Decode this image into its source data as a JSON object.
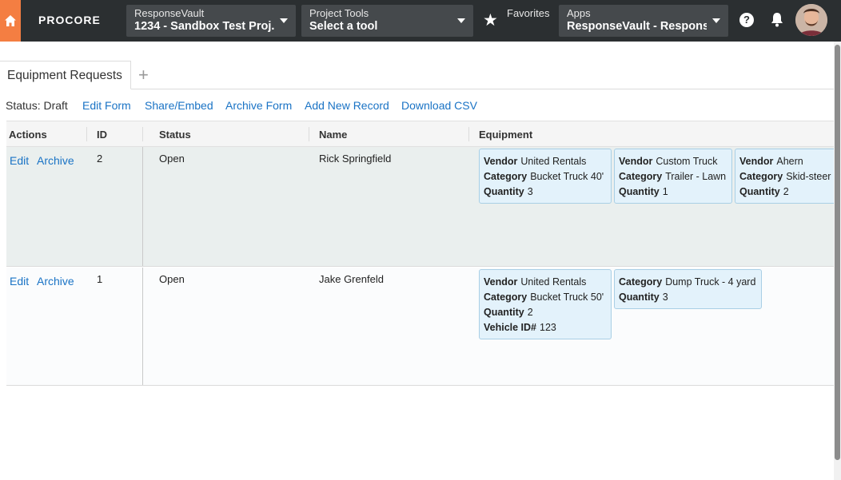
{
  "nav": {
    "logo": "PROCORE",
    "project_selector": {
      "sub": "ResponseVault",
      "main": "1234 - Sandbox Test Proj..."
    },
    "tool_selector": {
      "sub": "Project Tools",
      "main": "Select a tool"
    },
    "favorites_label": "Favorites",
    "apps_selector": {
      "sub": "Apps",
      "main": "ResponseVault - Respons..."
    },
    "help_label": "?",
    "brand_color": "#f47e42"
  },
  "tabs": [
    {
      "label": "Equipment Requests"
    }
  ],
  "add_tab": "+",
  "toolbar": {
    "status": "Status: Draft",
    "links": [
      "Edit Form",
      "Share/Embed",
      "Archive Form",
      "Add New Record",
      "Download CSV"
    ]
  },
  "table": {
    "headers": [
      "Actions",
      "ID",
      "Status",
      "Name",
      "Equipment"
    ],
    "rows": [
      {
        "edit": "Edit",
        "archive": "Archive",
        "id": "2",
        "status": "Open",
        "name": "Rick Springfield",
        "equipment": [
          {
            "vendor_label": "Vendor",
            "vendor": "United Rentals",
            "category_label": "Category",
            "category": "Bucket Truck 40'",
            "quantity_label": "Quantity",
            "quantity": "3"
          },
          {
            "vendor_label": "Vendor",
            "vendor": "Custom Truck",
            "category_label": "Category",
            "category": "Trailer - Lawn",
            "quantity_label": "Quantity",
            "quantity": "1"
          },
          {
            "vendor_label": "Vendor",
            "vendor": "Ahern",
            "category_label": "Category",
            "category": "Skid-steer",
            "quantity_label": "Quantity",
            "quantity": "2"
          }
        ]
      },
      {
        "edit": "Edit",
        "archive": "Archive",
        "id": "1",
        "status": "Open",
        "name": "Jake Grenfeld",
        "equipment": [
          {
            "vendor_label": "Vendor",
            "vendor": "United Rentals",
            "category_label": "Category",
            "category": "Bucket Truck 50'",
            "quantity_label": "Quantity",
            "quantity": "2",
            "vehicle_label": "Vehicle ID#",
            "vehicle": "123"
          },
          {
            "category_label": "Category",
            "category": "Dump Truck - 4 yard",
            "quantity_label": "Quantity",
            "quantity": "3"
          }
        ]
      }
    ]
  }
}
